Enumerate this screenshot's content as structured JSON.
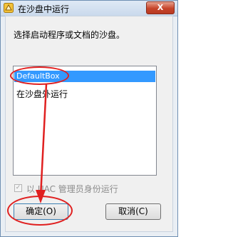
{
  "window": {
    "title": "在沙盘中运行",
    "close_label": "X"
  },
  "prompt": "选择启动程序或文档的沙盘。",
  "list": {
    "items": [
      {
        "label": "DefaultBox",
        "selected": true
      },
      {
        "label": "在沙盘外运行",
        "selected": false
      }
    ]
  },
  "checkbox": {
    "label": "以 UAC 管理员身份运行",
    "checked": true,
    "enabled": false
  },
  "buttons": {
    "ok": "确定(O)",
    "cancel": "取消(C)"
  },
  "annotations": {
    "color": "#e02020"
  }
}
